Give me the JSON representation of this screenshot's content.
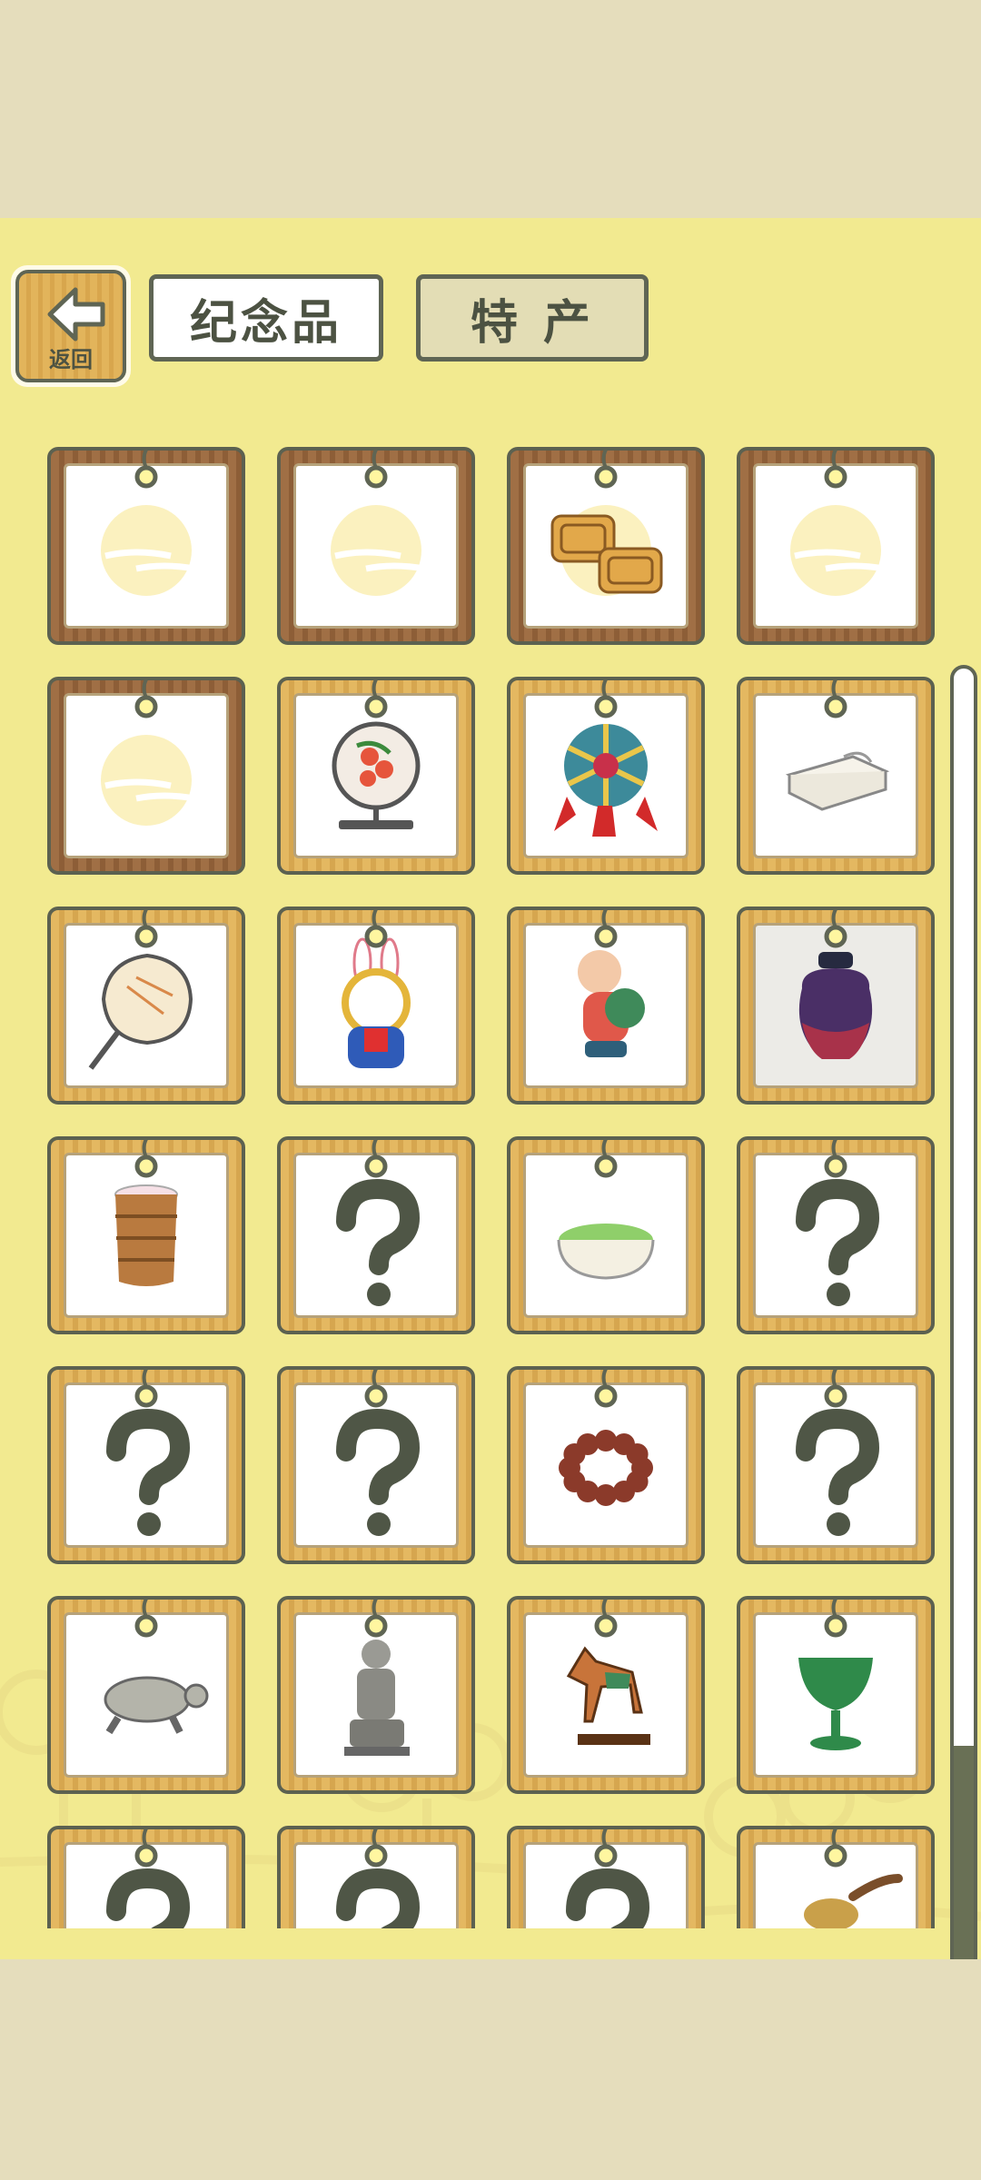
{
  "header": {
    "back_label": "返回",
    "tabs": [
      {
        "label": "纪念品",
        "active": true
      },
      {
        "label": "特产",
        "active": false
      }
    ]
  },
  "grid": {
    "columns": 4,
    "items": [
      {
        "icon": "moon-placeholder-icon",
        "frame": "dark"
      },
      {
        "icon": "moon-placeholder-icon",
        "frame": "dark"
      },
      {
        "icon": "mooncake-icon",
        "frame": "dark"
      },
      {
        "icon": "moon-placeholder-icon",
        "frame": "dark"
      },
      {
        "icon": "moon-placeholder-icon",
        "frame": "dark"
      },
      {
        "icon": "embroidery-screen-icon",
        "frame": "gold"
      },
      {
        "icon": "embroidered-ball-icon",
        "frame": "gold"
      },
      {
        "icon": "folded-cloth-icon",
        "frame": "gold"
      },
      {
        "icon": "round-fan-icon",
        "frame": "gold"
      },
      {
        "icon": "rabbit-figurine-icon",
        "frame": "gold"
      },
      {
        "icon": "clay-doll-icon",
        "frame": "gold"
      },
      {
        "icon": "glazed-jar-icon",
        "frame": "gold",
        "shade": "grey"
      },
      {
        "icon": "bamboo-cup-icon",
        "frame": "gold"
      },
      {
        "icon": "question-mark-icon",
        "frame": "gold"
      },
      {
        "icon": "matcha-powder-icon",
        "frame": "gold"
      },
      {
        "icon": "question-mark-icon",
        "frame": "gold"
      },
      {
        "icon": "question-mark-icon",
        "frame": "gold"
      },
      {
        "icon": "question-mark-icon",
        "frame": "gold"
      },
      {
        "icon": "prayer-beads-icon",
        "frame": "gold"
      },
      {
        "icon": "question-mark-icon",
        "frame": "gold"
      },
      {
        "icon": "stone-turtle-icon",
        "frame": "gold"
      },
      {
        "icon": "terracotta-warrior-icon",
        "frame": "gold"
      },
      {
        "icon": "tang-horse-icon",
        "frame": "gold"
      },
      {
        "icon": "jade-cup-icon",
        "frame": "gold"
      },
      {
        "icon": "question-mark-icon",
        "frame": "gold"
      },
      {
        "icon": "question-mark-icon",
        "frame": "gold"
      },
      {
        "icon": "question-mark-icon",
        "frame": "gold"
      },
      {
        "icon": "ladle-icon",
        "frame": "gold"
      }
    ]
  },
  "scroll": {
    "position": 0.0
  }
}
